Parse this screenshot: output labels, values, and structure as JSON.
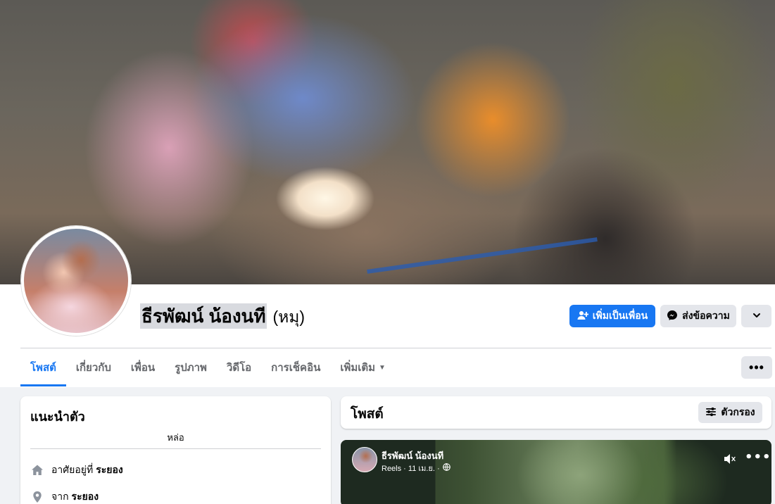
{
  "profile": {
    "name": "ธีรพัฒน์ น้องนที",
    "alternate_name": "(หมุ)"
  },
  "actions": {
    "add_friend_label": "เพิ่มเป็นเพื่อน",
    "message_label": "ส่งข้อความ"
  },
  "tabs": [
    {
      "label": "โพสต์"
    },
    {
      "label": "เกี่ยวกับ"
    },
    {
      "label": "เพื่อน"
    },
    {
      "label": "รูปภาพ"
    },
    {
      "label": "วิดีโอ"
    },
    {
      "label": "การเช็คอิน"
    },
    {
      "label": "เพิ่มเติม"
    }
  ],
  "intro": {
    "title": "แนะนำตัว",
    "bio": "หล่อ",
    "lives_in_prefix": "อาศัยอยู่ที่",
    "lives_in_value": "ระยอง",
    "from_prefix": "จาก",
    "from_value": "ระยอง"
  },
  "posts": {
    "title": "โพสต์",
    "filter_label": "ตัวกรอง"
  },
  "reel": {
    "author": "ธีรพัฒน์ น้องนที",
    "meta": "Reels · 11 เม.ย. ·"
  },
  "colors": {
    "accent": "#1877f2",
    "secondary_button": "#e4e6eb",
    "page_background": "#f0f2f5"
  }
}
